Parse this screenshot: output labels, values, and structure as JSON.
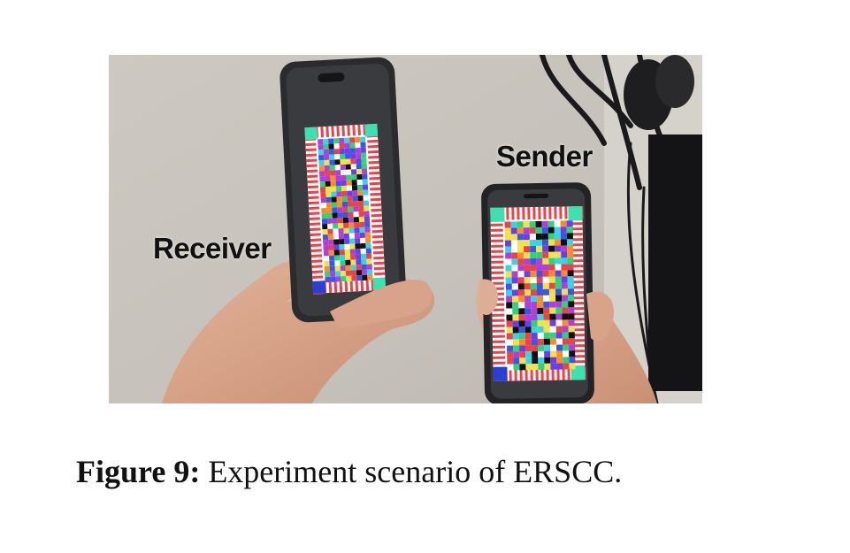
{
  "photo": {
    "labels": {
      "receiver": "Receiver",
      "sender": "Sender"
    },
    "colors": {
      "wall": "#c9c4bd",
      "skin": "#d9a98f",
      "phone_body": "#2b2b2e",
      "code_stripe": "#e8424a",
      "corner_marker": "#3ee0b0"
    }
  },
  "caption": {
    "label": "Figure 9:",
    "text": "Experiment scenario of ERSCC."
  }
}
